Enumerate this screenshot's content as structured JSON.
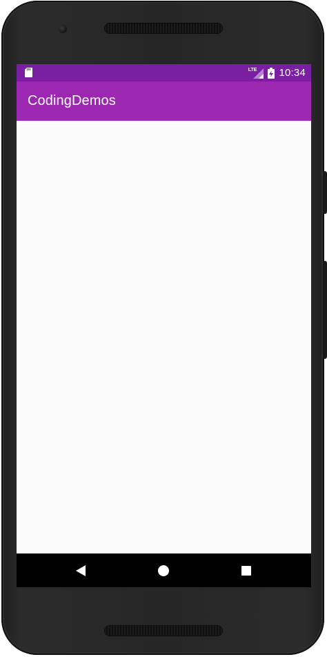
{
  "status_bar": {
    "network_label": "LTE",
    "time": "10:34",
    "icons": [
      "sd-card-icon",
      "signal-icon",
      "battery-charging-icon"
    ]
  },
  "app_bar": {
    "title": "CodingDemos"
  },
  "nav_bar": {
    "icons": [
      "back-icon",
      "home-icon",
      "recents-icon"
    ]
  },
  "colors": {
    "status_bar": "#7b1fa2",
    "app_bar": "#9c27b0",
    "content_background": "#fafafa",
    "nav_bar": "#000000",
    "device_frame": "#262626"
  }
}
